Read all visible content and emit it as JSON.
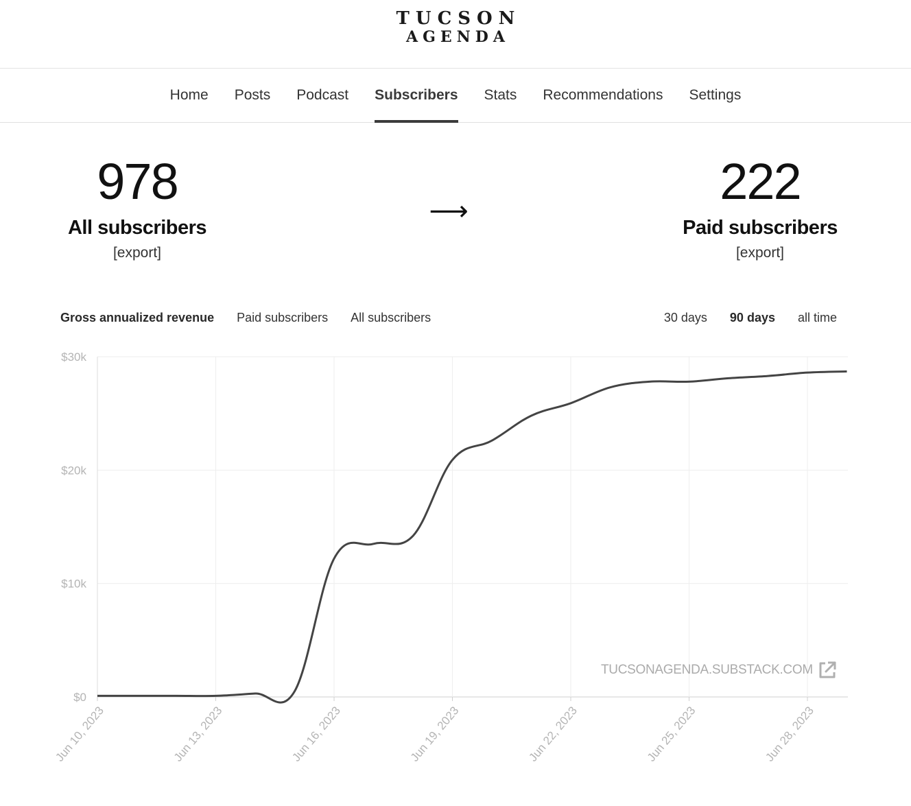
{
  "publication": {
    "logo_line1": "TUCSON",
    "logo_line2": "AGENDA"
  },
  "nav": {
    "items": [
      {
        "label": "Home"
      },
      {
        "label": "Posts"
      },
      {
        "label": "Podcast"
      },
      {
        "label": "Subscribers",
        "active": true
      },
      {
        "label": "Stats"
      },
      {
        "label": "Recommendations"
      },
      {
        "label": "Settings"
      }
    ]
  },
  "stats": {
    "all": {
      "number": "978",
      "label": "All subscribers",
      "export": "[export]"
    },
    "arrow": "⟶",
    "paid": {
      "number": "222",
      "label": "Paid subscribers",
      "export": "[export]"
    }
  },
  "chart_tabs": {
    "metrics": [
      {
        "label": "Gross annualized revenue",
        "active": true
      },
      {
        "label": "Paid subscribers"
      },
      {
        "label": "All subscribers"
      }
    ],
    "ranges": [
      {
        "label": "30 days"
      },
      {
        "label": "90 days",
        "active": true
      },
      {
        "label": "all time"
      }
    ]
  },
  "watermark": {
    "text": "TUCSONAGENDA.SUBSTACK.COM",
    "icon": "external-link-icon"
  },
  "colors": {
    "line": "#444444",
    "grid": "#eeeeee",
    "axis_text": "#b4b4b4"
  },
  "chart_data": {
    "type": "line",
    "title": "",
    "xlabel": "",
    "ylabel": "",
    "ylim": [
      0,
      30000
    ],
    "yticks": [
      0,
      10000,
      20000,
      30000
    ],
    "ytick_labels": [
      "$0",
      "$10k",
      "$20k",
      "$30k"
    ],
    "xticks": [
      "2023-06-10",
      "2023-06-13",
      "2023-06-16",
      "2023-06-19",
      "2023-06-22",
      "2023-06-25",
      "2023-06-28"
    ],
    "xtick_labels": [
      "Jun 10, 2023",
      "Jun 13, 2023",
      "Jun 16, 2023",
      "Jun 19, 2023",
      "Jun 22, 2023",
      "Jun 25, 2023",
      "Jun 28, 2023"
    ],
    "grid": true,
    "series": [
      {
        "x": [
          "2023-06-10",
          "2023-06-11",
          "2023-06-12",
          "2023-06-13",
          "2023-06-14",
          "2023-06-15",
          "2023-06-16",
          "2023-06-17",
          "2023-06-18",
          "2023-06-19",
          "2023-06-20",
          "2023-06-21",
          "2023-06-22",
          "2023-06-23",
          "2023-06-24",
          "2023-06-25",
          "2023-06-26",
          "2023-06-27",
          "2023-06-28",
          "2023-06-29"
        ],
        "values": [
          100,
          100,
          100,
          100,
          300,
          500,
          12200,
          13500,
          14200,
          20900,
          22600,
          24800,
          25900,
          27300,
          27800,
          27800,
          28100,
          28300,
          28600,
          28700
        ]
      }
    ]
  }
}
